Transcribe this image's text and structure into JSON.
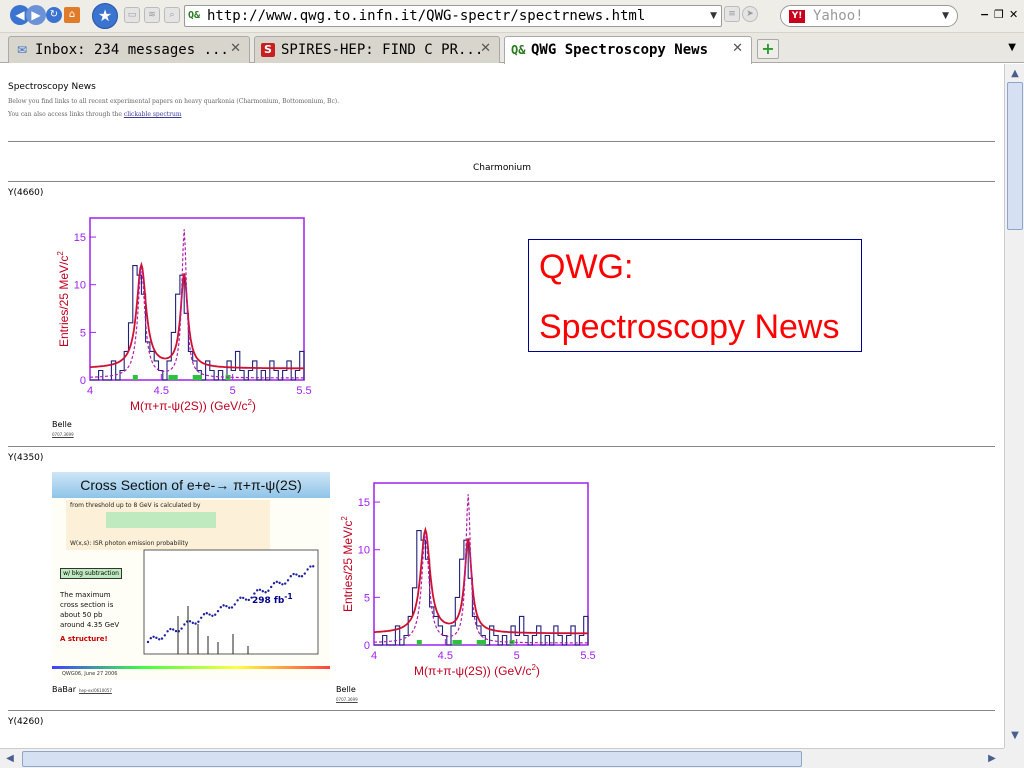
{
  "browser": {
    "url": "http://www.qwg.to.infn.it/QWG-spectr/spectrnews.html",
    "search_placeholder": "Yahoo!",
    "tabs": [
      {
        "label": "Inbox: 234 messages ...",
        "icon": "mail-icon"
      },
      {
        "label": "SPIRES-HEP: FIND C PR...",
        "icon": "spires-icon"
      },
      {
        "label": "QWG Spectroscopy News",
        "icon": "qwg-icon",
        "active": true
      }
    ],
    "close_glyph": "✕",
    "new_tab_glyph": "+"
  },
  "page": {
    "title": "Spectroscopy News",
    "intro_line1": "Below you find links to all recent experimental papers on heavy quarkonia (Charmonium, Bottomonium, Bc).",
    "intro_line2_prefix": "You can also access links through the",
    "intro_link": "clickable spectrum",
    "section_header": "Charmonium",
    "box_title_line1": "QWG:",
    "box_title_line2": "Spectroscopy News",
    "entries": [
      {
        "name": "Y(4660)",
        "figures": [
          {
            "caption": "Belle",
            "small": "0707.3699"
          }
        ]
      },
      {
        "name": "Y(4350)",
        "figures": [
          {
            "caption": "BaBar",
            "small": "hep-ex/0610057"
          },
          {
            "caption": "Belle",
            "small": "0707.3699"
          }
        ]
      },
      {
        "name": "Y(4260)"
      }
    ]
  },
  "plot_labels": {
    "ylabel": "Entries/25 MeV/c",
    "ylabel_sup": "2",
    "xlabel": "M(π+π-ψ(2S)) (GeV/c",
    "xlabel_end": ")",
    "xticks": [
      "4",
      "4.5",
      "5",
      "5.5"
    ],
    "yticks": [
      "0",
      "5",
      "10",
      "15"
    ]
  },
  "babar_plot": {
    "title": "Cross Section of e+e-→ π+π-ψ(2S)",
    "note1": "from threshold up to 8 GeV is calculated by",
    "note2": "W(x,s): ISR photon emission probability",
    "box1": "w/ bkg subtraction",
    "text1": "The maximum",
    "text2": "cross section is",
    "text3": "about 50 pb",
    "text4": "around 4.35 GeV",
    "text5": "A structure!",
    "lumi": "298 fb",
    "lumi_sup": "-1",
    "footer": "QWG06, June 27 2006"
  },
  "colors": {
    "accent_red": "#ff0000",
    "box_border": "#00008b",
    "plot_frame": "#a020f0"
  }
}
